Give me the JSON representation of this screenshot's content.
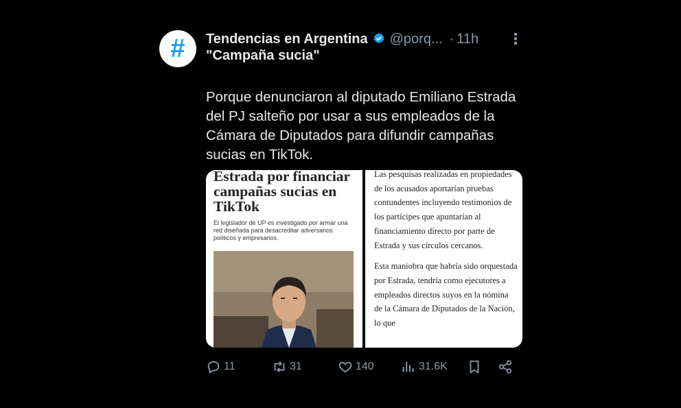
{
  "tweet": {
    "avatar_glyph": "#",
    "author_name": "Tendencias en Argentina",
    "handle": "@porq...",
    "separator": "·",
    "time": "11h",
    "more_glyph": "⋮",
    "topic": "\"Campaña sucia\"",
    "text": "Porque denunciaron al diputado Emiliano Estrada del PJ salteño por usar a sus empleados de la Cámara de Diputados para difundir campañas sucias en TikTok."
  },
  "media": {
    "headline": "Estrada por financiar campañas sucias en TikTok",
    "subhead": "El legislador de UP es investigado por armar una red diseñada para desacreditar adversarios políticos y empresarios.",
    "article_paragraphs": [
      "Las pesquisas realizadas en propiedades de los acusados aportarían pruebas contundentes incluyendo testimonios de los partícipes que apuntarían al financiamiento directo por parte de Estrada y sus círculos cercanos.",
      "Esta maniobra que habría sido orquestada por Estrada, tendría como ejecutores a empleados directos suyos en la nómina de la Cámara de Diputados de la Nación, lo que"
    ]
  },
  "actions": {
    "replies": "11",
    "retweets": "31",
    "likes": "140",
    "views": "31.6K"
  },
  "colors": {
    "background": "#000000",
    "text": "#e7e9ea",
    "secondary": "#8b98a5",
    "accent": "#1d9bf0"
  },
  "icons": {
    "avatar": "hashtag-icon",
    "verified": "verified-badge-icon",
    "reply": "reply-icon",
    "retweet": "retweet-icon",
    "like": "heart-icon",
    "views": "views-icon",
    "bookmark": "bookmark-icon",
    "share": "share-icon"
  }
}
